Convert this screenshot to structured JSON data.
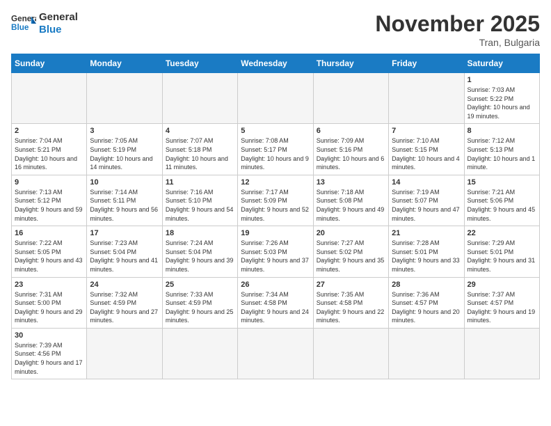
{
  "header": {
    "logo_general": "General",
    "logo_blue": "Blue",
    "month_title": "November 2025",
    "subtitle": "Tran, Bulgaria"
  },
  "weekdays": [
    "Sunday",
    "Monday",
    "Tuesday",
    "Wednesday",
    "Thursday",
    "Friday",
    "Saturday"
  ],
  "weeks": [
    [
      {
        "day": "",
        "empty": true
      },
      {
        "day": "",
        "empty": true
      },
      {
        "day": "",
        "empty": true
      },
      {
        "day": "",
        "empty": true
      },
      {
        "day": "",
        "empty": true
      },
      {
        "day": "",
        "empty": true
      },
      {
        "day": "1",
        "sunrise": "Sunrise: 7:03 AM",
        "sunset": "Sunset: 5:22 PM",
        "daylight": "Daylight: 10 hours and 19 minutes."
      }
    ],
    [
      {
        "day": "2",
        "sunrise": "Sunrise: 7:04 AM",
        "sunset": "Sunset: 5:21 PM",
        "daylight": "Daylight: 10 hours and 16 minutes."
      },
      {
        "day": "3",
        "sunrise": "Sunrise: 7:05 AM",
        "sunset": "Sunset: 5:19 PM",
        "daylight": "Daylight: 10 hours and 14 minutes."
      },
      {
        "day": "4",
        "sunrise": "Sunrise: 7:07 AM",
        "sunset": "Sunset: 5:18 PM",
        "daylight": "Daylight: 10 hours and 11 minutes."
      },
      {
        "day": "5",
        "sunrise": "Sunrise: 7:08 AM",
        "sunset": "Sunset: 5:17 PM",
        "daylight": "Daylight: 10 hours and 9 minutes."
      },
      {
        "day": "6",
        "sunrise": "Sunrise: 7:09 AM",
        "sunset": "Sunset: 5:16 PM",
        "daylight": "Daylight: 10 hours and 6 minutes."
      },
      {
        "day": "7",
        "sunrise": "Sunrise: 7:10 AM",
        "sunset": "Sunset: 5:15 PM",
        "daylight": "Daylight: 10 hours and 4 minutes."
      },
      {
        "day": "8",
        "sunrise": "Sunrise: 7:12 AM",
        "sunset": "Sunset: 5:13 PM",
        "daylight": "Daylight: 10 hours and 1 minute."
      }
    ],
    [
      {
        "day": "9",
        "sunrise": "Sunrise: 7:13 AM",
        "sunset": "Sunset: 5:12 PM",
        "daylight": "Daylight: 9 hours and 59 minutes."
      },
      {
        "day": "10",
        "sunrise": "Sunrise: 7:14 AM",
        "sunset": "Sunset: 5:11 PM",
        "daylight": "Daylight: 9 hours and 56 minutes."
      },
      {
        "day": "11",
        "sunrise": "Sunrise: 7:16 AM",
        "sunset": "Sunset: 5:10 PM",
        "daylight": "Daylight: 9 hours and 54 minutes."
      },
      {
        "day": "12",
        "sunrise": "Sunrise: 7:17 AM",
        "sunset": "Sunset: 5:09 PM",
        "daylight": "Daylight: 9 hours and 52 minutes."
      },
      {
        "day": "13",
        "sunrise": "Sunrise: 7:18 AM",
        "sunset": "Sunset: 5:08 PM",
        "daylight": "Daylight: 9 hours and 49 minutes."
      },
      {
        "day": "14",
        "sunrise": "Sunrise: 7:19 AM",
        "sunset": "Sunset: 5:07 PM",
        "daylight": "Daylight: 9 hours and 47 minutes."
      },
      {
        "day": "15",
        "sunrise": "Sunrise: 7:21 AM",
        "sunset": "Sunset: 5:06 PM",
        "daylight": "Daylight: 9 hours and 45 minutes."
      }
    ],
    [
      {
        "day": "16",
        "sunrise": "Sunrise: 7:22 AM",
        "sunset": "Sunset: 5:05 PM",
        "daylight": "Daylight: 9 hours and 43 minutes."
      },
      {
        "day": "17",
        "sunrise": "Sunrise: 7:23 AM",
        "sunset": "Sunset: 5:04 PM",
        "daylight": "Daylight: 9 hours and 41 minutes."
      },
      {
        "day": "18",
        "sunrise": "Sunrise: 7:24 AM",
        "sunset": "Sunset: 5:04 PM",
        "daylight": "Daylight: 9 hours and 39 minutes."
      },
      {
        "day": "19",
        "sunrise": "Sunrise: 7:26 AM",
        "sunset": "Sunset: 5:03 PM",
        "daylight": "Daylight: 9 hours and 37 minutes."
      },
      {
        "day": "20",
        "sunrise": "Sunrise: 7:27 AM",
        "sunset": "Sunset: 5:02 PM",
        "daylight": "Daylight: 9 hours and 35 minutes."
      },
      {
        "day": "21",
        "sunrise": "Sunrise: 7:28 AM",
        "sunset": "Sunset: 5:01 PM",
        "daylight": "Daylight: 9 hours and 33 minutes."
      },
      {
        "day": "22",
        "sunrise": "Sunrise: 7:29 AM",
        "sunset": "Sunset: 5:01 PM",
        "daylight": "Daylight: 9 hours and 31 minutes."
      }
    ],
    [
      {
        "day": "23",
        "sunrise": "Sunrise: 7:31 AM",
        "sunset": "Sunset: 5:00 PM",
        "daylight": "Daylight: 9 hours and 29 minutes."
      },
      {
        "day": "24",
        "sunrise": "Sunrise: 7:32 AM",
        "sunset": "Sunset: 4:59 PM",
        "daylight": "Daylight: 9 hours and 27 minutes."
      },
      {
        "day": "25",
        "sunrise": "Sunrise: 7:33 AM",
        "sunset": "Sunset: 4:59 PM",
        "daylight": "Daylight: 9 hours and 25 minutes."
      },
      {
        "day": "26",
        "sunrise": "Sunrise: 7:34 AM",
        "sunset": "Sunset: 4:58 PM",
        "daylight": "Daylight: 9 hours and 24 minutes."
      },
      {
        "day": "27",
        "sunrise": "Sunrise: 7:35 AM",
        "sunset": "Sunset: 4:58 PM",
        "daylight": "Daylight: 9 hours and 22 minutes."
      },
      {
        "day": "28",
        "sunrise": "Sunrise: 7:36 AM",
        "sunset": "Sunset: 4:57 PM",
        "daylight": "Daylight: 9 hours and 20 minutes."
      },
      {
        "day": "29",
        "sunrise": "Sunrise: 7:37 AM",
        "sunset": "Sunset: 4:57 PM",
        "daylight": "Daylight: 9 hours and 19 minutes."
      }
    ],
    [
      {
        "day": "30",
        "sunrise": "Sunrise: 7:39 AM",
        "sunset": "Sunset: 4:56 PM",
        "daylight": "Daylight: 9 hours and 17 minutes."
      },
      {
        "day": "",
        "empty": true
      },
      {
        "day": "",
        "empty": true
      },
      {
        "day": "",
        "empty": true
      },
      {
        "day": "",
        "empty": true
      },
      {
        "day": "",
        "empty": true
      },
      {
        "day": "",
        "empty": true
      }
    ]
  ]
}
